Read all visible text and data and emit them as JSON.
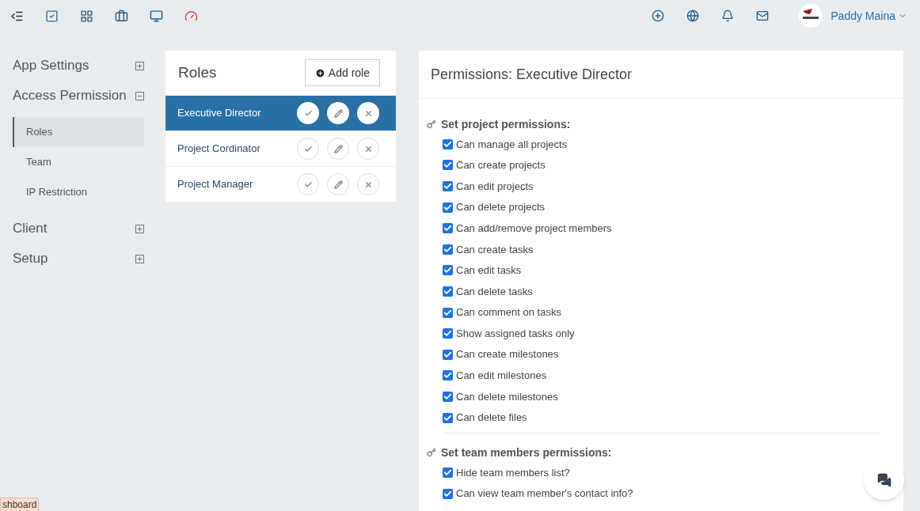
{
  "user": {
    "name": "Paddy Maina"
  },
  "sidebar": {
    "groups": [
      {
        "label": "App Settings",
        "expanded": false
      },
      {
        "label": "Access Permission",
        "expanded": true,
        "items": [
          {
            "label": "Roles",
            "selected": true
          },
          {
            "label": "Team",
            "selected": false
          },
          {
            "label": "IP Restriction",
            "selected": false
          }
        ]
      },
      {
        "label": "Client",
        "expanded": false
      },
      {
        "label": "Setup",
        "expanded": false
      }
    ]
  },
  "roles": {
    "title": "Roles",
    "add_button": "Add role",
    "items": [
      {
        "name": "Executive Director",
        "selected": true
      },
      {
        "name": "Project Cordinator",
        "selected": false
      },
      {
        "name": "Project Manager",
        "selected": false
      }
    ]
  },
  "permissions": {
    "title": "Permissions: Executive Director",
    "sections": [
      {
        "title": "Set project permissions:",
        "items": [
          {
            "label": "Can manage all projects",
            "checked": true
          },
          {
            "label": "Can create projects",
            "checked": true
          },
          {
            "label": "Can edit projects",
            "checked": true
          },
          {
            "label": "Can delete projects",
            "checked": true
          },
          {
            "label": "Can add/remove project members",
            "checked": true
          },
          {
            "label": "Can create tasks",
            "checked": true
          },
          {
            "label": "Can edit tasks",
            "checked": true
          },
          {
            "label": "Can delete tasks",
            "checked": true
          },
          {
            "label": "Can comment on tasks",
            "checked": true
          },
          {
            "label": "Show assigned tasks only",
            "checked": true
          },
          {
            "label": "Can create milestones",
            "checked": true
          },
          {
            "label": "Can edit milestones",
            "checked": true
          },
          {
            "label": "Can delete milestones",
            "checked": true
          },
          {
            "label": "Can delete files",
            "checked": true
          }
        ]
      },
      {
        "title": "Set team members permissions:",
        "items": [
          {
            "label": "Hide team members list?",
            "checked": true
          },
          {
            "label": "Can view team member's contact info?",
            "checked": true
          }
        ]
      }
    ]
  },
  "tooltip": "shboard"
}
